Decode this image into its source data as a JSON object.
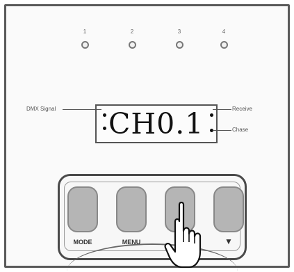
{
  "leds": [
    {
      "number": "1"
    },
    {
      "number": "2"
    },
    {
      "number": "3"
    },
    {
      "number": "4"
    }
  ],
  "display": {
    "left_dots": ":",
    "channel_text": "CH0.1",
    "right_dots": ":"
  },
  "callouts": {
    "dmx_signal": "DMX Signal",
    "receive": "Receive",
    "chase": "Chase"
  },
  "keypad": {
    "keys": [
      {
        "label": "MODE"
      },
      {
        "label": "MENU"
      },
      {
        "label": ""
      },
      {
        "label": "▼"
      }
    ]
  }
}
